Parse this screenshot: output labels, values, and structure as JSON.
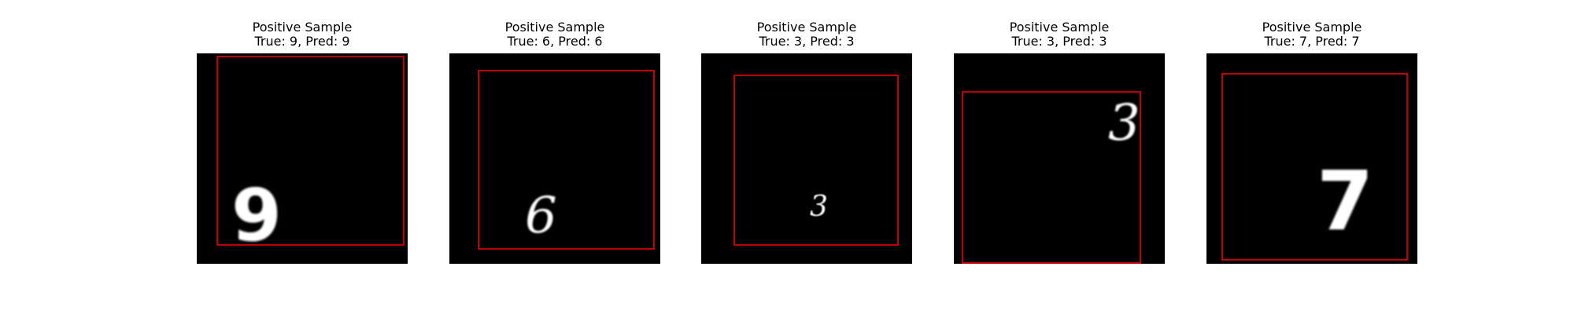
{
  "figure": {
    "panels": [
      {
        "title": "Positive Sample",
        "true_label": "9",
        "pred_label": "9",
        "subtitle": "True: 9, Pred: 9",
        "digit": "9",
        "box_color": "#ff0000",
        "digit_color": "#ffffff"
      },
      {
        "title": "Positive Sample",
        "true_label": "6",
        "pred_label": "6",
        "subtitle": "True: 6, Pred: 6",
        "digit": "6",
        "box_color": "#ff0000",
        "digit_color": "#ffffff"
      },
      {
        "title": "Positive Sample",
        "true_label": "3",
        "pred_label": "3",
        "subtitle": "True: 3, Pred: 3",
        "digit": "3",
        "box_color": "#ff0000",
        "digit_color": "#ffffff"
      },
      {
        "title": "Positive Sample",
        "true_label": "3",
        "pred_label": "3",
        "subtitle": "True: 3, Pred: 3",
        "digit": "3",
        "box_color": "#ff0000",
        "digit_color": "#ffffff"
      },
      {
        "title": "Positive Sample",
        "true_label": "7",
        "pred_label": "7",
        "subtitle": "True: 7, Pred: 7",
        "digit": "7",
        "box_color": "#ff0000",
        "digit_color": "#ffffff"
      }
    ]
  }
}
